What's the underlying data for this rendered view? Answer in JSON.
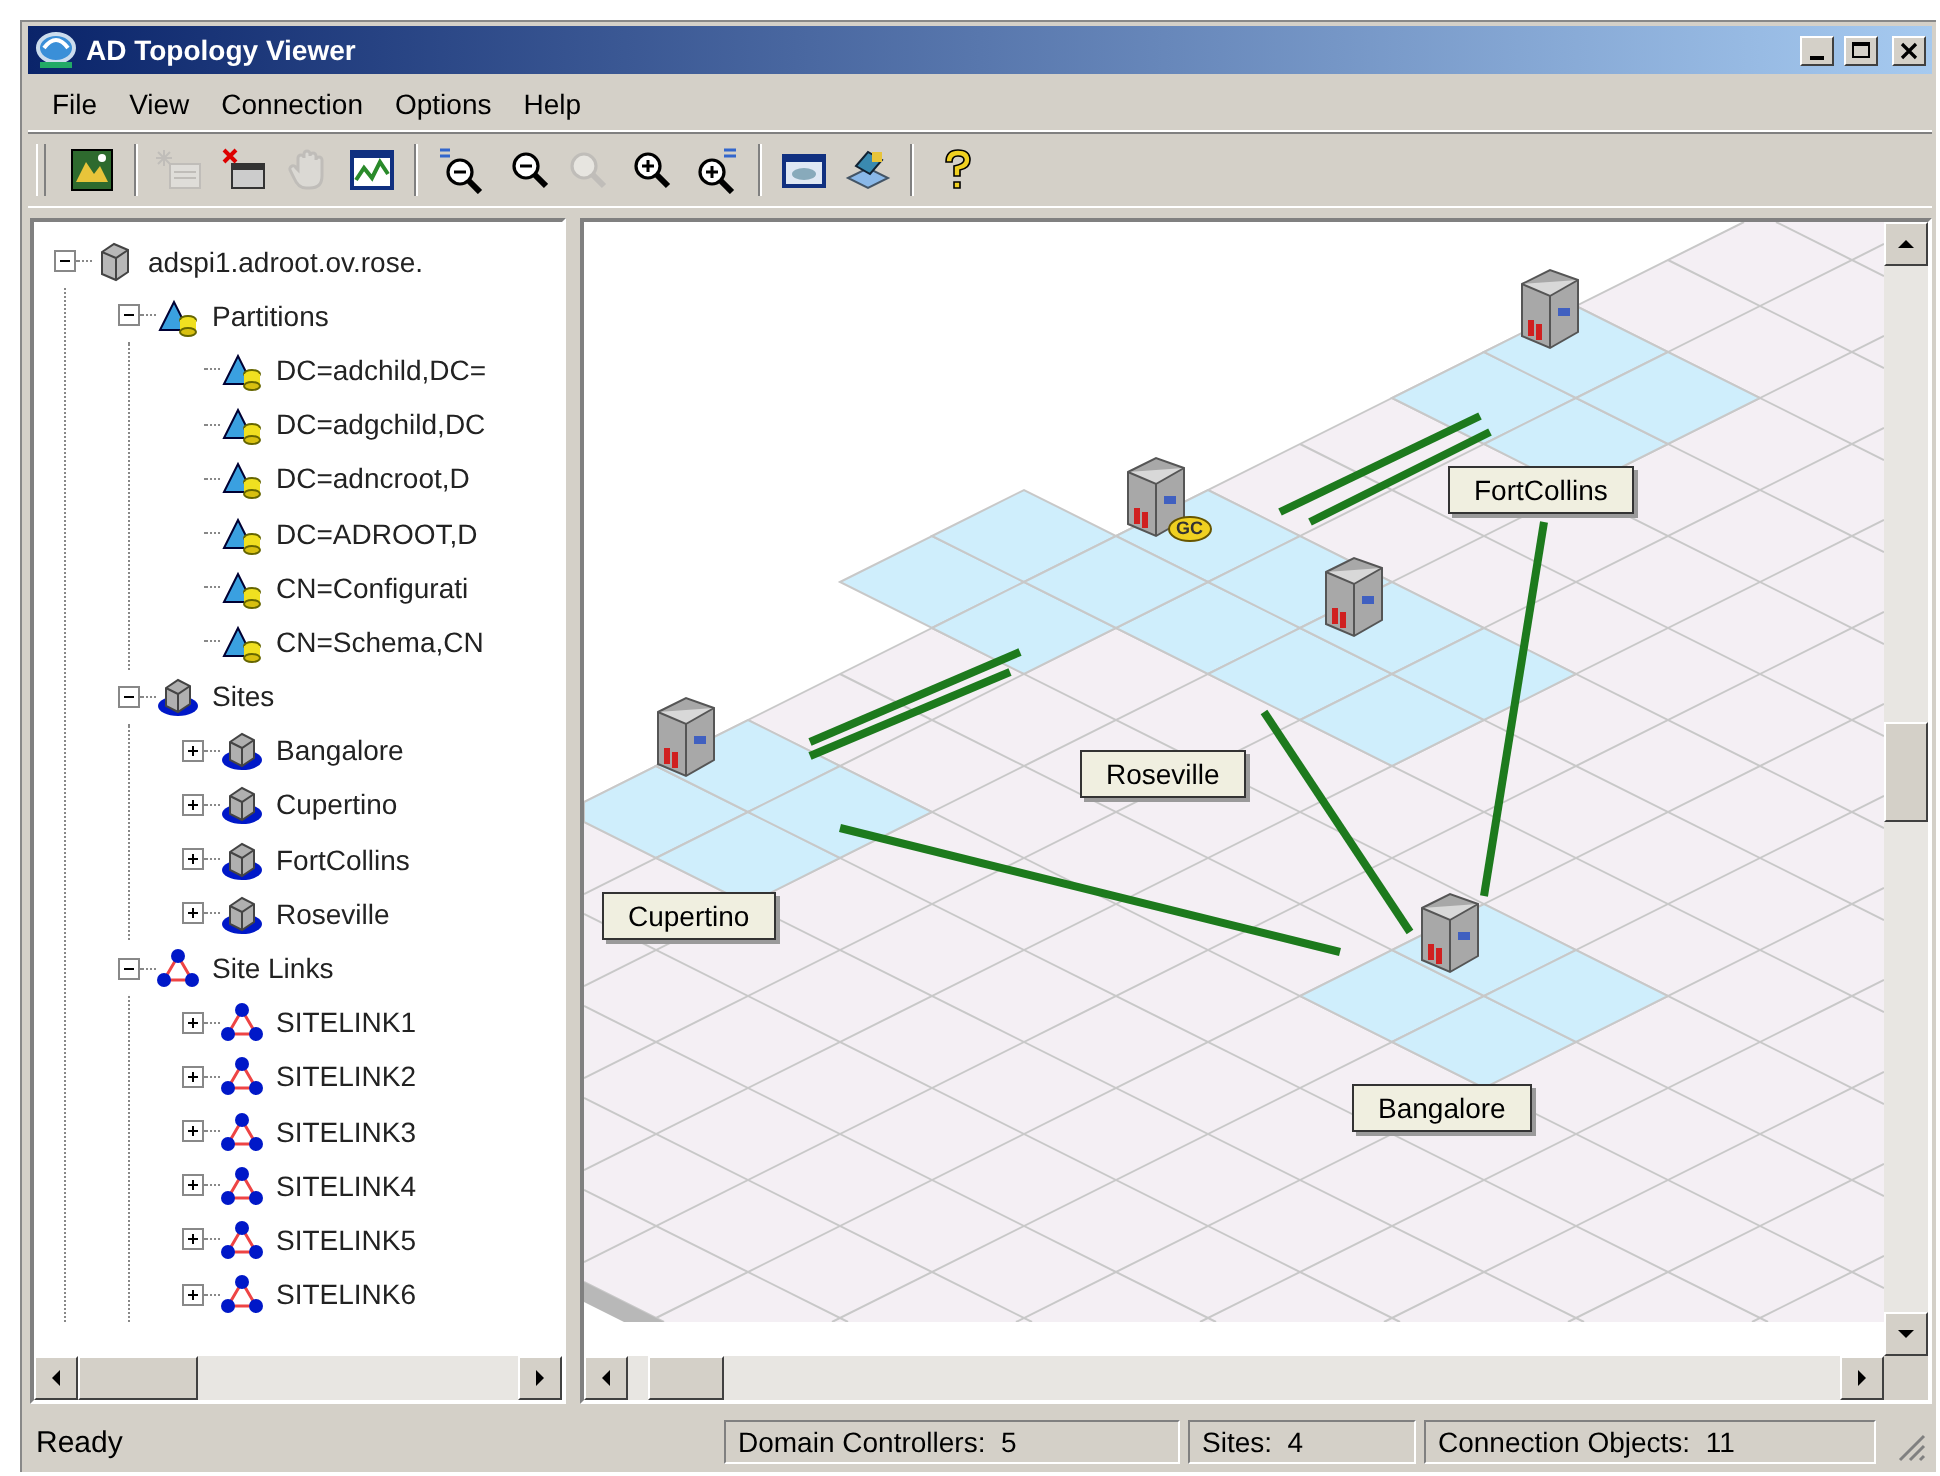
{
  "window": {
    "title": "AD Topology Viewer"
  },
  "menu": [
    "File",
    "View",
    "Connection",
    "Options",
    "Help"
  ],
  "toolbar": [
    {
      "kind": "map",
      "disabled": false
    },
    {
      "kind": "separator"
    },
    {
      "kind": "new-item",
      "disabled": true
    },
    {
      "kind": "delete-item",
      "disabled": false
    },
    {
      "kind": "hand",
      "disabled": true
    },
    {
      "kind": "graph",
      "disabled": false
    },
    {
      "kind": "separator"
    },
    {
      "kind": "zoom-out-max",
      "disabled": false
    },
    {
      "kind": "zoom-out",
      "disabled": false
    },
    {
      "kind": "zoom",
      "disabled": true
    },
    {
      "kind": "zoom-in",
      "disabled": false
    },
    {
      "kind": "zoom-in-max",
      "disabled": false
    },
    {
      "kind": "separator"
    },
    {
      "kind": "window",
      "disabled": false
    },
    {
      "kind": "layers",
      "disabled": false
    },
    {
      "kind": "separator"
    },
    {
      "kind": "help",
      "disabled": false
    }
  ],
  "tree": [
    {
      "label": "adspi1.adroot.ov.rose.",
      "kind": "server",
      "expanded": true,
      "children": [
        {
          "label": "Partitions",
          "kind": "partition",
          "expanded": true,
          "children": [
            {
              "label": "DC=adchild,DC=",
              "kind": "partition"
            },
            {
              "label": "DC=adgchild,DC",
              "kind": "partition"
            },
            {
              "label": "DC=adncroot,D",
              "kind": "partition"
            },
            {
              "label": "DC=ADROOT,D",
              "kind": "partition"
            },
            {
              "label": "CN=Configurati",
              "kind": "partition"
            },
            {
              "label": "CN=Schema,CN",
              "kind": "partition"
            }
          ]
        },
        {
          "label": "Sites",
          "kind": "site",
          "expanded": true,
          "children": [
            {
              "label": "Bangalore",
              "kind": "site",
              "expanded": false
            },
            {
              "label": "Cupertino",
              "kind": "site",
              "expanded": false
            },
            {
              "label": "FortCollins",
              "kind": "site",
              "expanded": false
            },
            {
              "label": "Roseville",
              "kind": "site",
              "expanded": false
            }
          ]
        },
        {
          "label": "Site Links",
          "kind": "sitelink",
          "expanded": true,
          "children": [
            {
              "label": "SITELINK1",
              "kind": "sitelink",
              "expanded": false
            },
            {
              "label": "SITELINK2",
              "kind": "sitelink",
              "expanded": false
            },
            {
              "label": "SITELINK3",
              "kind": "sitelink",
              "expanded": false
            },
            {
              "label": "SITELINK4",
              "kind": "sitelink",
              "expanded": false
            },
            {
              "label": "SITELINK5",
              "kind": "sitelink",
              "expanded": false
            },
            {
              "label": "SITELINK6",
              "kind": "sitelink",
              "expanded": false
            }
          ]
        }
      ]
    }
  ],
  "topology": {
    "sites": [
      {
        "label": "FortCollins"
      },
      {
        "label": "Roseville",
        "gc_badge": "GC"
      },
      {
        "label": "Cupertino"
      },
      {
        "label": "Bangalore"
      }
    ]
  },
  "status_bar": [
    "Ready",
    "Domain Controllers:  5",
    "Sites:  4",
    "Connection Objects:  11"
  ]
}
